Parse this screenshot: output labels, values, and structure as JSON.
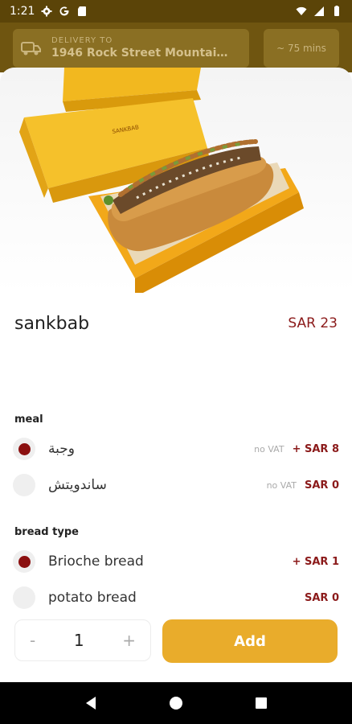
{
  "status_bar": {
    "time": "1:21",
    "icons_left": [
      "gear-icon",
      "g-icon",
      "sd-card-icon"
    ],
    "icons_right": [
      "wifi-icon",
      "signal-icon",
      "battery-icon"
    ]
  },
  "header": {
    "delivery_label": "DELIVERY TO",
    "delivery_address": "1946 Rock Street Mountain ...",
    "eta": "~ 75 mins"
  },
  "product": {
    "name": "sankbab",
    "price": "SAR 23"
  },
  "sections": [
    {
      "title": "meal",
      "options": [
        {
          "label": "وجبة",
          "vat": "no VAT",
          "price": "+ SAR 8",
          "selected": true
        },
        {
          "label": "ساندويتش",
          "vat": "no VAT",
          "price": "SAR 0",
          "selected": false
        }
      ]
    },
    {
      "title": "bread type",
      "options": [
        {
          "label": "Brioche bread",
          "vat": "",
          "price": "+ SAR 1",
          "selected": true
        },
        {
          "label": "potato bread",
          "vat": "",
          "price": "SAR 0",
          "selected": false
        }
      ]
    }
  ],
  "cart": {
    "minus": "-",
    "quantity": "1",
    "plus": "+",
    "add_label": "Add"
  },
  "colors": {
    "accent": "#e9ac2b",
    "price": "#8b1a1a",
    "status_bar": "#5b4408"
  }
}
